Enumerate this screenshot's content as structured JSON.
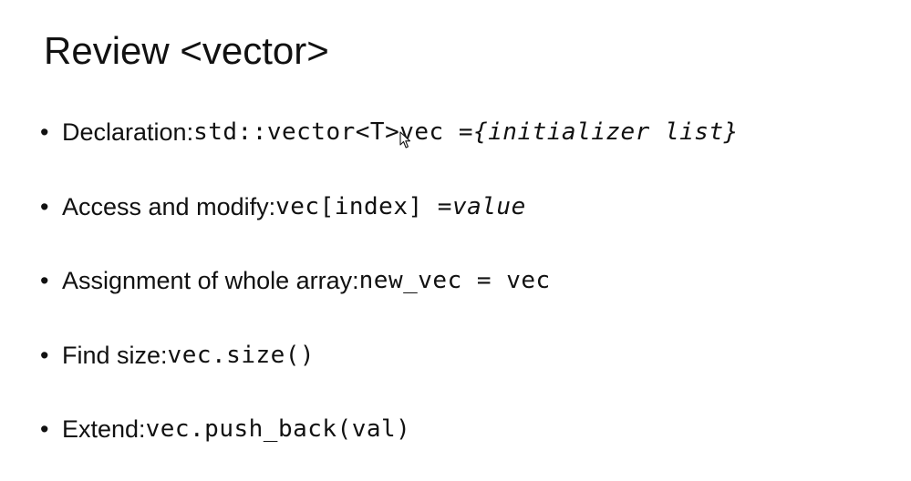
{
  "slide": {
    "title": "Review <vector>",
    "bullets": [
      {
        "label": "Declaration: ",
        "code": "std::vector<T>vec = ",
        "code_italic": "{initializer list}"
      },
      {
        "label": "Access and modify: ",
        "code": "vec[index] = ",
        "code_italic": "value"
      },
      {
        "label": "Assignment of whole array: ",
        "code": "new_vec = vec",
        "code_italic": ""
      },
      {
        "label": "Find size: ",
        "code": "vec.size()",
        "code_italic": ""
      },
      {
        "label": "Extend: ",
        "code": "vec.push_back(val)",
        "code_italic": ""
      }
    ],
    "bullet_glyph": "•"
  },
  "icons": {
    "cursor": "mouse-pointer-icon"
  },
  "colors": {
    "background": "#ffffff",
    "text": "#111111"
  }
}
